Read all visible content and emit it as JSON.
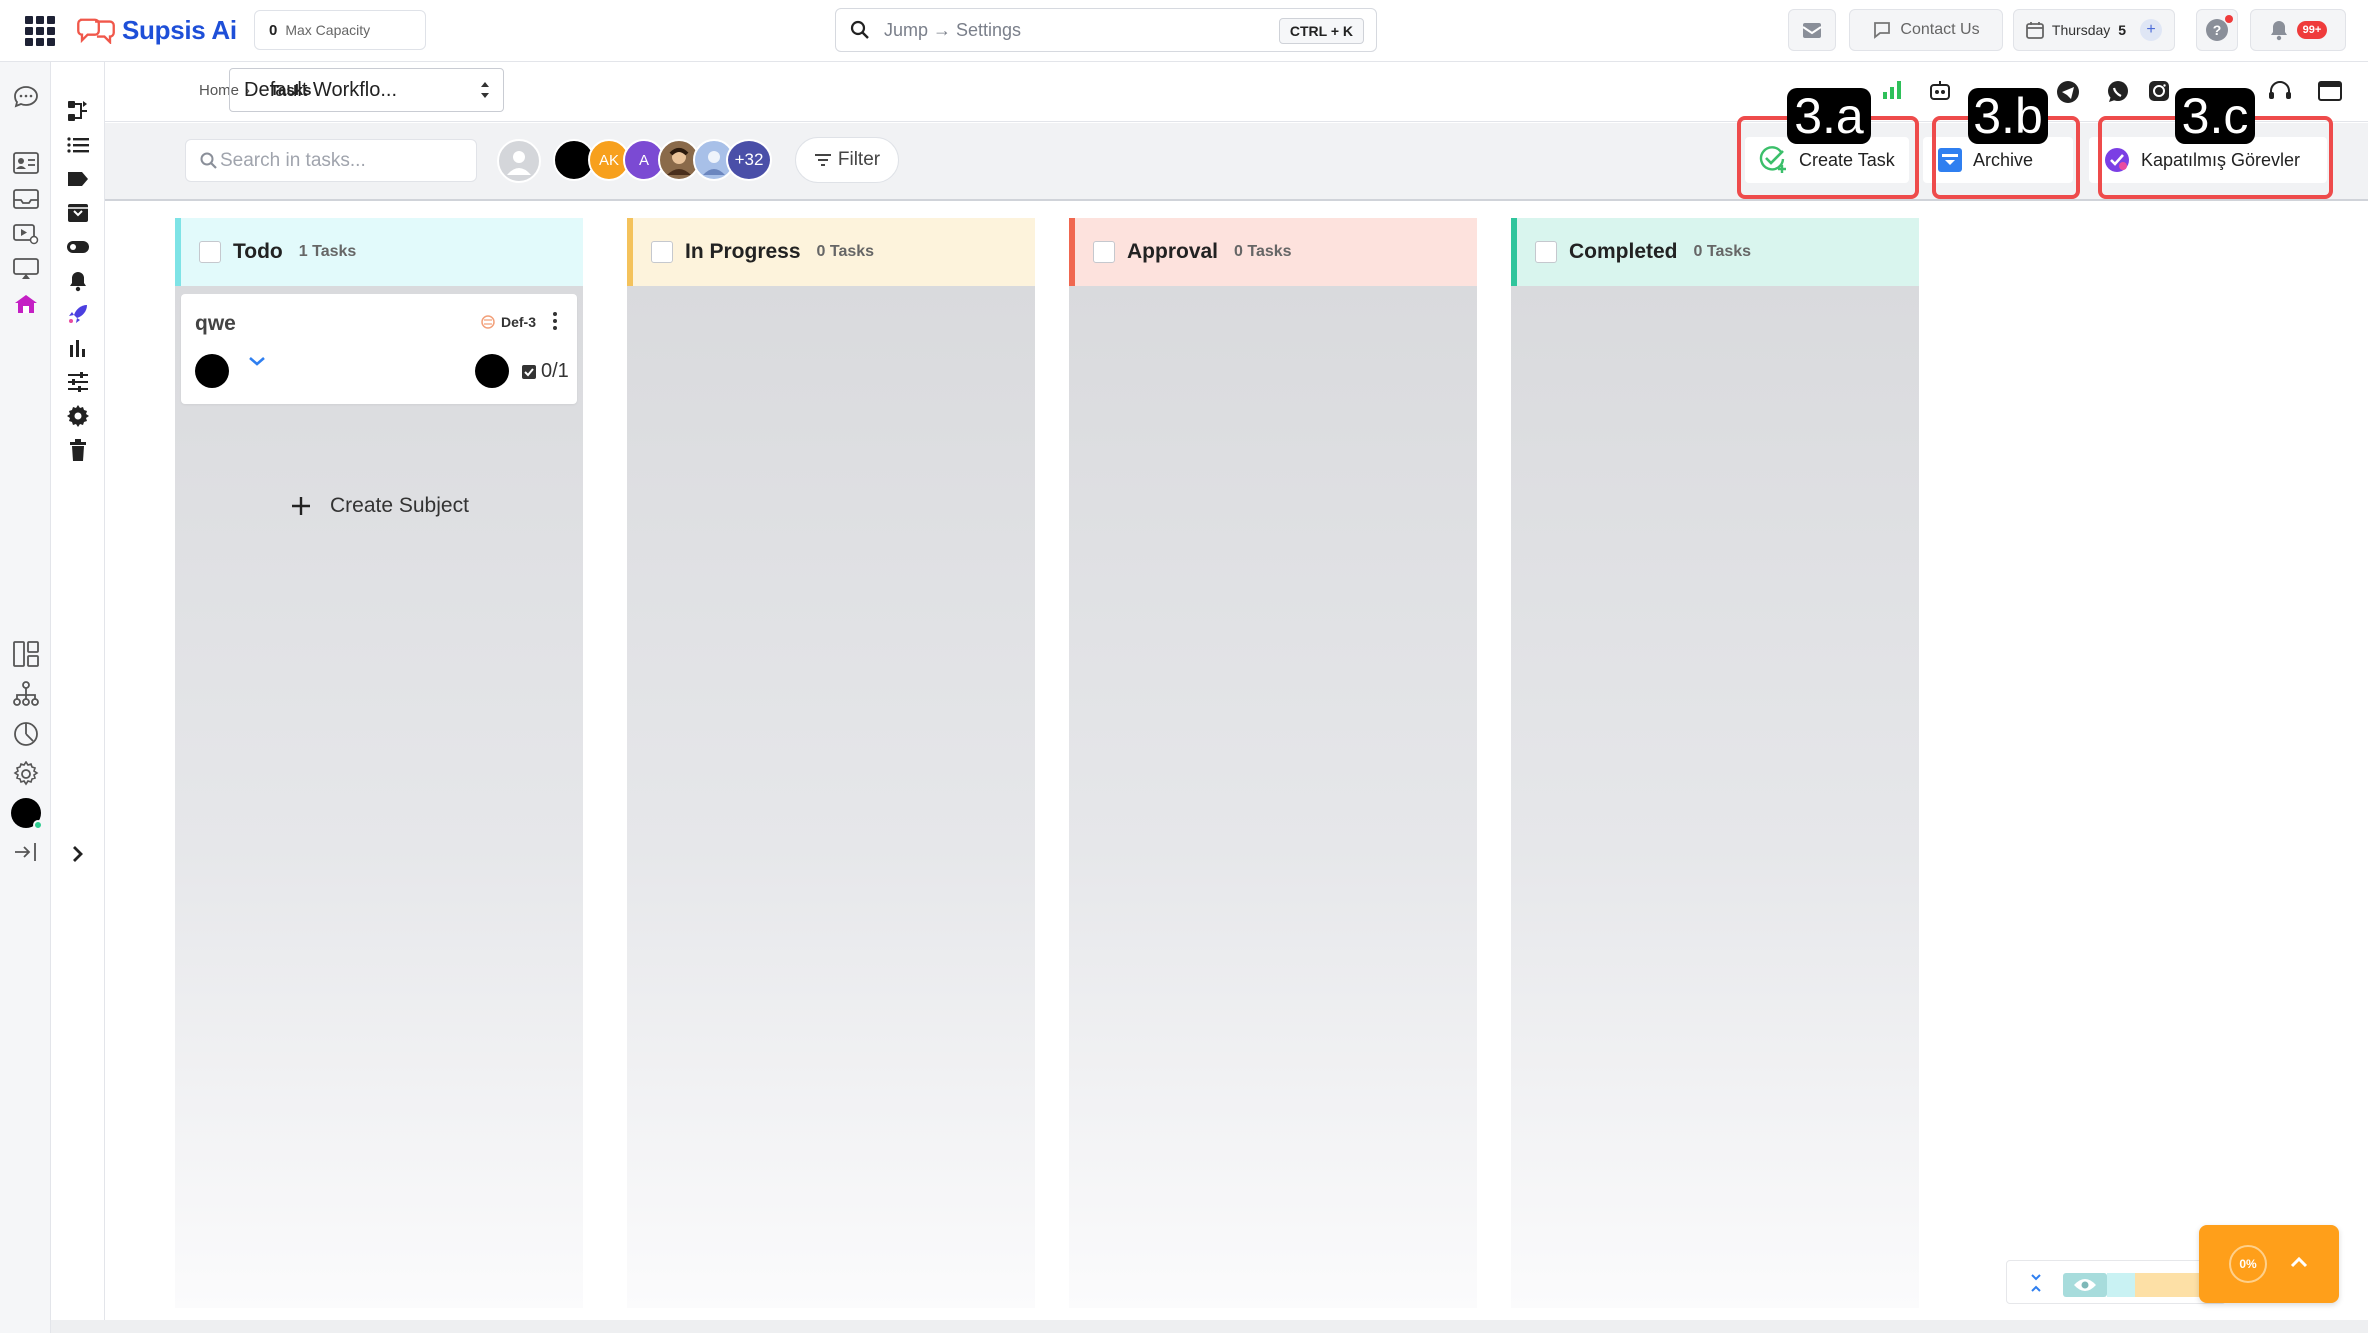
{
  "app": {
    "name": "Supsis Ai",
    "brand_color": "#1e4fd8",
    "accent_magenta": "#c41fc4"
  },
  "topbar": {
    "capacity_value": "0",
    "capacity_label": "Max Capacity",
    "jump_placeholder": "Jump → Settings",
    "jump_shortcut": "CTRL + K",
    "contact_label": "Contact Us",
    "day_label": "Thursday",
    "day_number": "5",
    "notifications_badge": "99+"
  },
  "breadcrumb": {
    "home": "Home",
    "separator": "›",
    "current": "Tasks"
  },
  "workflow_select": {
    "value": "Default Workflo..."
  },
  "toolbar": {
    "search_placeholder": "Search in tasks...",
    "avatar_initials_1": "AK",
    "avatar_initials_2": "A",
    "avatar_more": "+32",
    "filter_label": "Filter",
    "create_task_label": "Create Task",
    "archive_label": "Archive",
    "closed_tasks_label": "Kapatılmış Görevler"
  },
  "annotations": {
    "a": "3.a",
    "b": "3.b",
    "c": "3.c",
    "color": "#ee4b4b"
  },
  "columns": [
    {
      "title": "Todo",
      "count": "1 Tasks",
      "accent": "#7ee3e6",
      "header_bg": "#e2fafb"
    },
    {
      "title": "In Progress",
      "count": "0 Tasks",
      "accent": "#f4c25b",
      "header_bg": "#fdf3dc"
    },
    {
      "title": "Approval",
      "count": "0 Tasks",
      "accent": "#f0674f",
      "header_bg": "#fde2dd"
    },
    {
      "title": "Completed",
      "count": "0 Tasks",
      "accent": "#2fc59c",
      "header_bg": "#d9f5ee"
    }
  ],
  "task_card": {
    "name": "qwe",
    "code": "Def-3",
    "progress": "0/1"
  },
  "create_subject_label": "Create Subject",
  "progress_widget": {
    "percent": "0%"
  }
}
